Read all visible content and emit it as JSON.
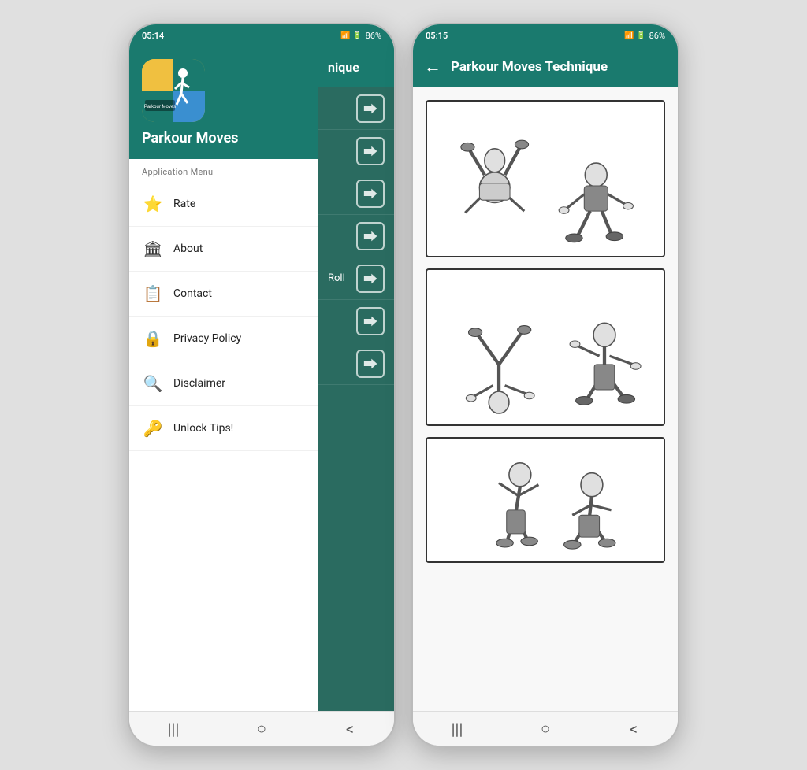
{
  "left_phone": {
    "status_bar": {
      "time": "05:14",
      "battery": "86%",
      "icons": "signal"
    },
    "app_name": "Parkour Moves",
    "menu_section_label": "Application Menu",
    "menu_items": [
      {
        "id": "rate",
        "label": "Rate",
        "icon": "⭐"
      },
      {
        "id": "about",
        "label": "About",
        "icon": "🏛"
      },
      {
        "id": "contact",
        "label": "Contact",
        "icon": "📋"
      },
      {
        "id": "privacy",
        "label": "Privacy Policy",
        "icon": "🔒"
      },
      {
        "id": "disclaimer",
        "label": "Disclaimer",
        "icon": "🔍"
      },
      {
        "id": "unlock",
        "label": "Unlock Tips!",
        "icon": "🔑"
      }
    ],
    "main_partial": {
      "title": "nique",
      "rows": [
        "",
        "",
        "",
        "Roll",
        "",
        ""
      ]
    },
    "nav": [
      "|||",
      "○",
      "<"
    ]
  },
  "right_phone": {
    "status_bar": {
      "time": "05:15",
      "battery": "86%"
    },
    "top_bar": {
      "title": "Parkour Moves Technique",
      "back_label": "←"
    },
    "nav": [
      "|||",
      "○",
      "<"
    ]
  }
}
